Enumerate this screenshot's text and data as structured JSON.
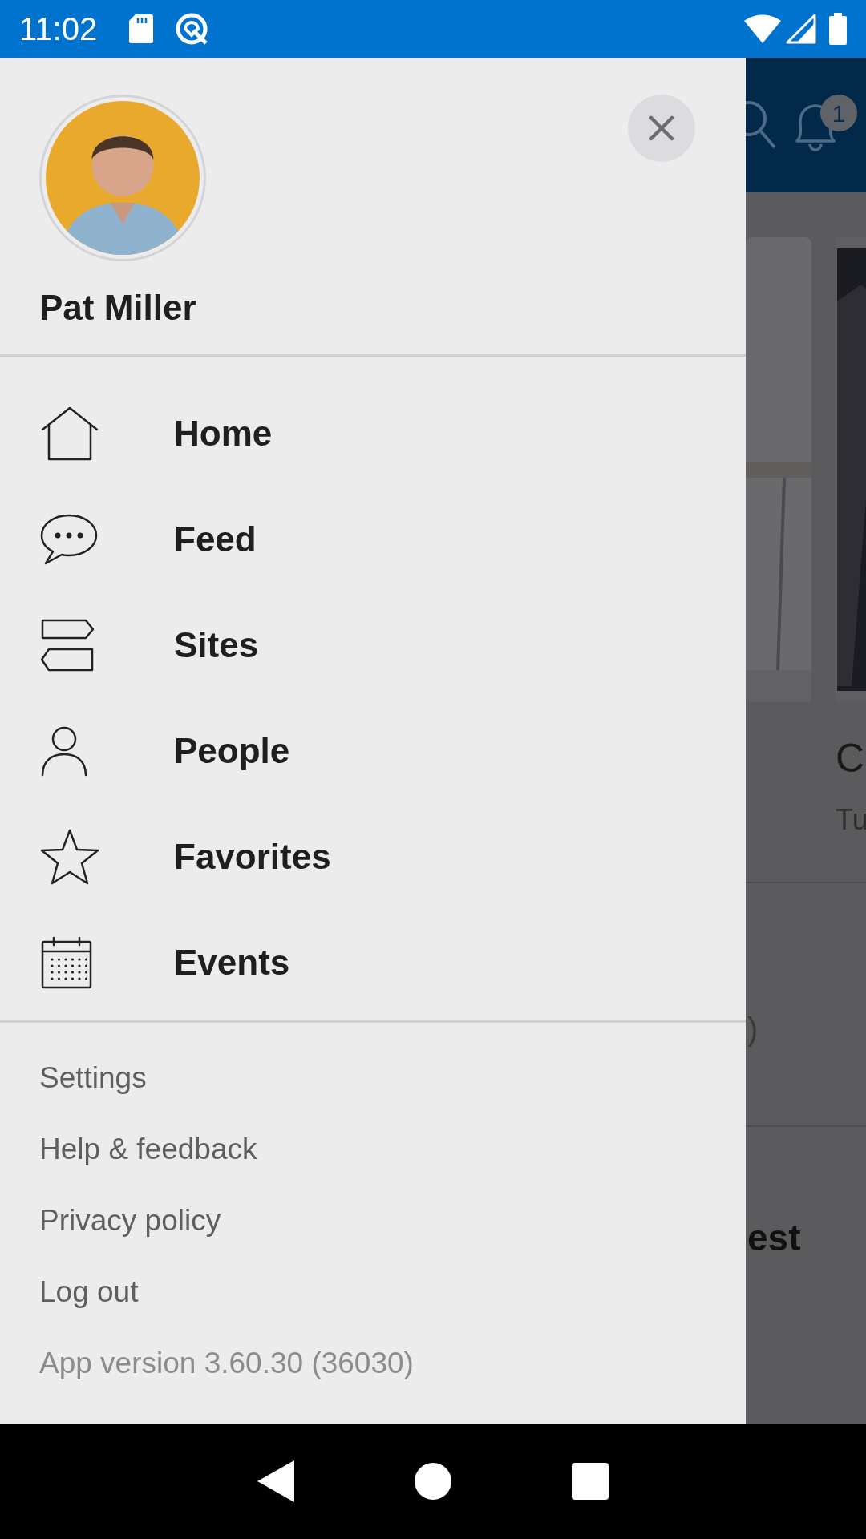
{
  "status_bar": {
    "time": "11:02"
  },
  "drawer": {
    "user_name": "Pat Miller",
    "menu": [
      {
        "kind": "home",
        "label": "Home"
      },
      {
        "kind": "feed",
        "label": "Feed"
      },
      {
        "kind": "sites",
        "label": "Sites"
      },
      {
        "kind": "people",
        "label": "People"
      },
      {
        "kind": "favorites",
        "label": "Favorites"
      },
      {
        "kind": "events",
        "label": "Events"
      }
    ],
    "footer_links": [
      "Settings",
      "Help & feedback",
      "Privacy policy",
      "Log out"
    ],
    "app_version": "App version 3.60.30 (36030)"
  },
  "background": {
    "notification_badge": "1",
    "card_title": "C",
    "card_subtitle": "Tu",
    "row_text": ")",
    "section_title": "est"
  }
}
